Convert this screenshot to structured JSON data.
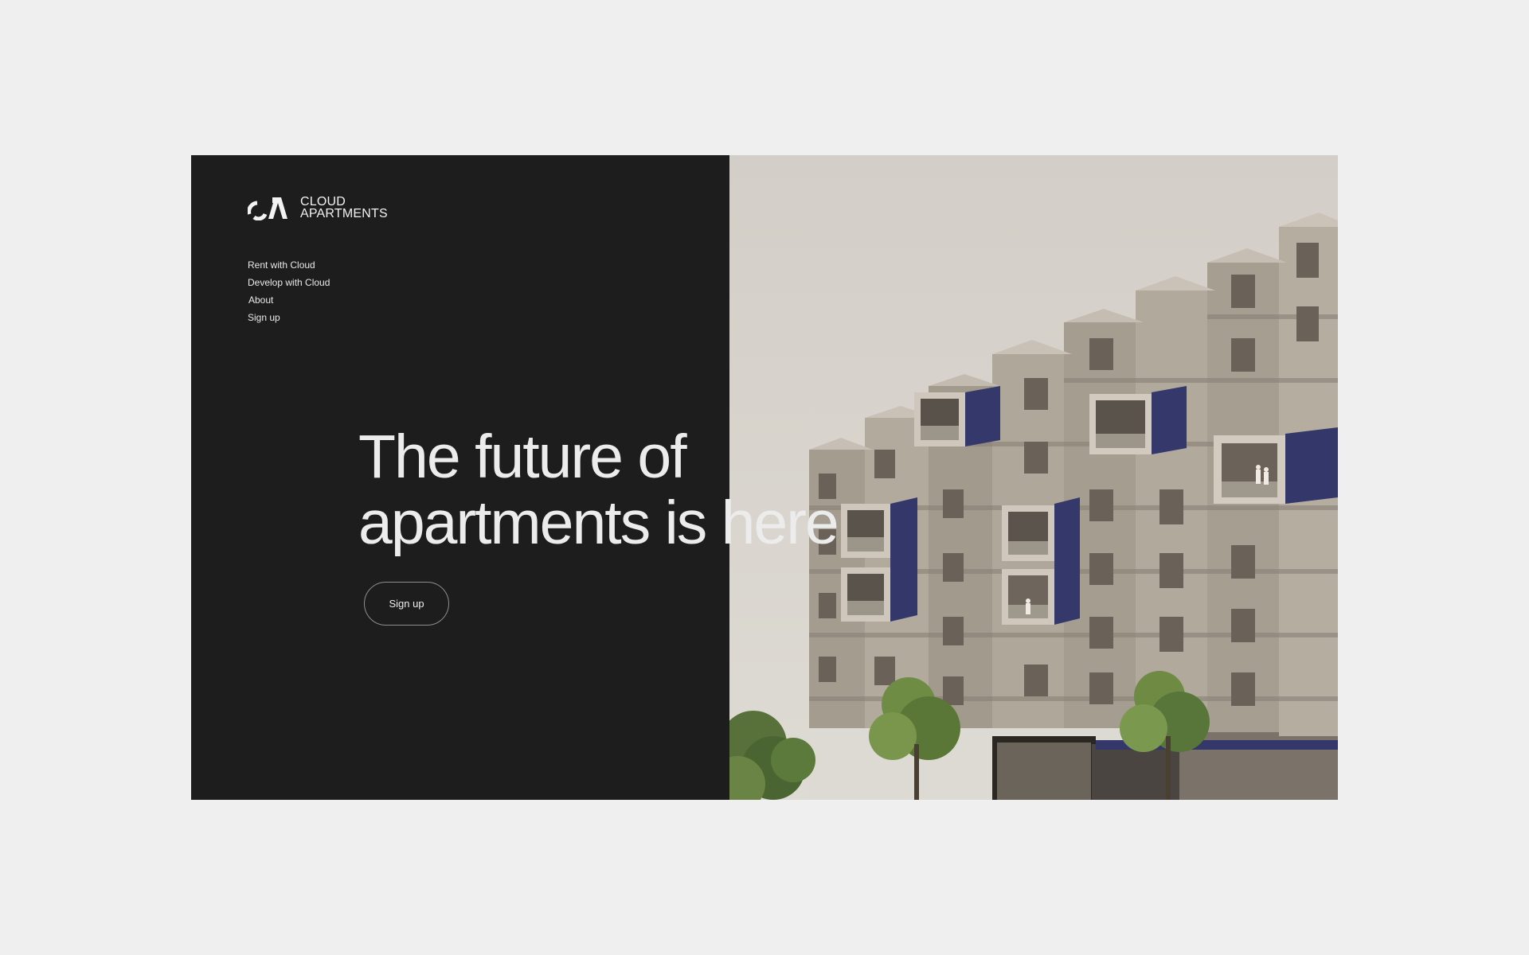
{
  "brand": {
    "line1": "CLOUD",
    "line2": "APARTMENTS",
    "logo_icon": "cloud-apartments-logo-icon"
  },
  "nav": {
    "items": [
      {
        "label": "Rent with Cloud"
      },
      {
        "label": "Develop with Cloud"
      },
      {
        "label": "About"
      },
      {
        "label": "Sign up"
      }
    ]
  },
  "hero": {
    "headline_line1": "The future of",
    "headline_line2": "apartments is here",
    "cta_label": "Sign up",
    "image": "apartment-building-photo"
  },
  "colors": {
    "page_background": "#efefef",
    "panel_background": "#1d1d1d",
    "text": "#ececec",
    "container_blue": "#3a3d6b"
  }
}
